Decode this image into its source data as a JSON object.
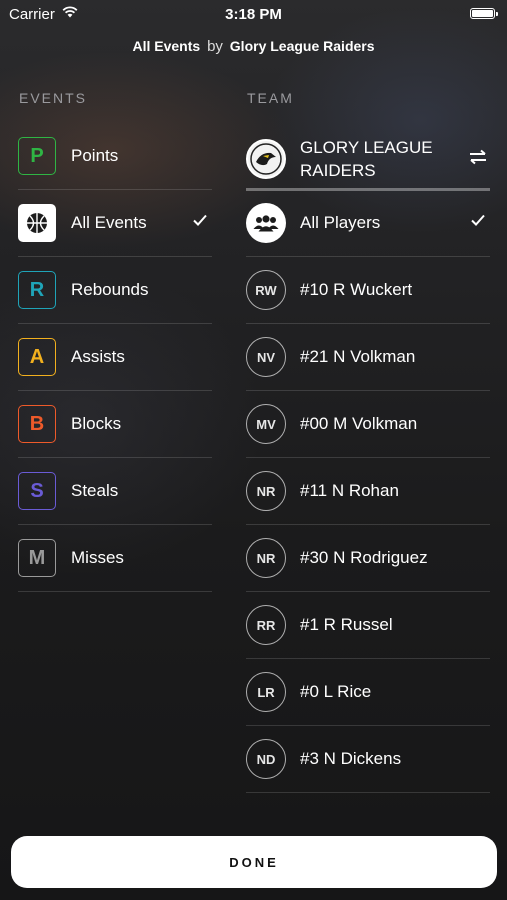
{
  "status_bar": {
    "carrier": "Carrier",
    "time": "3:18 PM"
  },
  "nav": {
    "event_name": "All Events",
    "by": "by",
    "team_name": "Glory League Raiders"
  },
  "events_header": "EVENTS",
  "team_header": "TEAM",
  "events": [
    {
      "letter": "P",
      "label": "Points",
      "color": "#2fb544",
      "icon": "points-icon"
    },
    {
      "letter": "",
      "label": "All Events",
      "color": "#ffffff",
      "icon": "basketball-icon",
      "selected": true
    },
    {
      "letter": "R",
      "label": "Rebounds",
      "color": "#1fa4b8",
      "icon": "rebounds-icon"
    },
    {
      "letter": "A",
      "label": "Assists",
      "color": "#f2b01e",
      "icon": "assists-icon"
    },
    {
      "letter": "B",
      "label": "Blocks",
      "color": "#ee5a2a",
      "icon": "blocks-icon"
    },
    {
      "letter": "S",
      "label": "Steals",
      "color": "#6a5bd6",
      "icon": "steals-icon"
    },
    {
      "letter": "M",
      "label": "Misses",
      "color": "#9a9a9a",
      "icon": "misses-icon"
    }
  ],
  "team": {
    "name_line1": "GLORY LEAGUE",
    "name_line2": "RAIDERS"
  },
  "players": [
    {
      "initials": "",
      "label": "All Players",
      "selected": true
    },
    {
      "initials": "RW",
      "label": "#10 R Wuckert"
    },
    {
      "initials": "NV",
      "label": "#21 N Volkman"
    },
    {
      "initials": "MV",
      "label": "#00 M Volkman"
    },
    {
      "initials": "NR",
      "label": "#11 N Rohan"
    },
    {
      "initials": "NR",
      "label": "#30 N Rodriguez"
    },
    {
      "initials": "RR",
      "label": "#1 R Russel"
    },
    {
      "initials": "LR",
      "label": "#0 L Rice"
    },
    {
      "initials": "ND",
      "label": "#3 N Dickens"
    }
  ],
  "done_label": "DONE"
}
